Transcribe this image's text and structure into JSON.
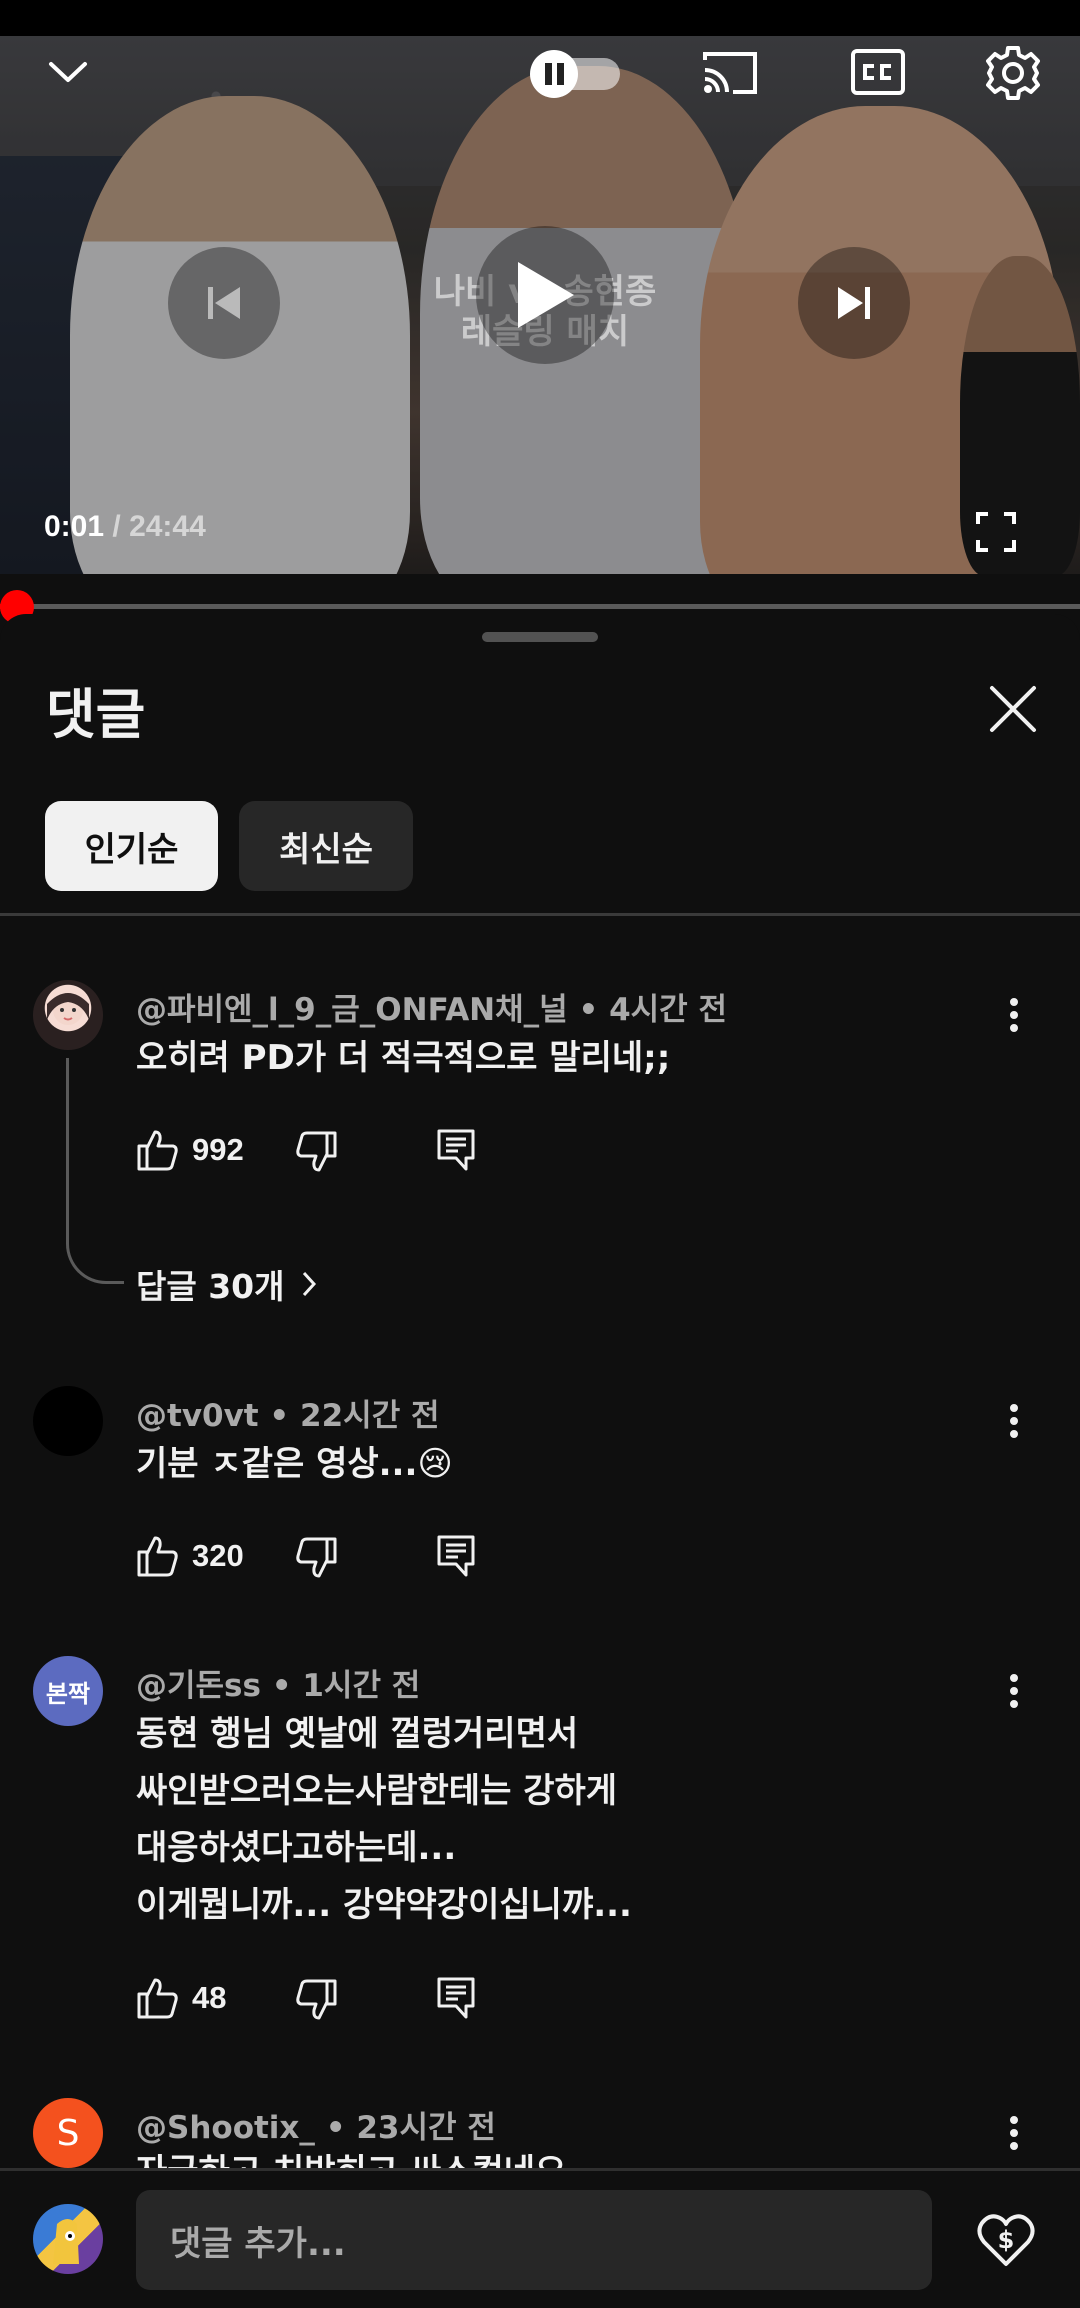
{
  "player": {
    "overlay_text_line1": "나비 vs 송현종",
    "overlay_text_line2": "레슬링 매치",
    "current_time": "0:01",
    "total_time": "24:44",
    "progress_fraction": 0.0004,
    "icons": [
      "chevron-down-icon",
      "pause-icon",
      "cast-icon",
      "cc-icon",
      "gear-icon",
      "previous-icon",
      "play-icon",
      "next-icon",
      "fullscreen-icon"
    ]
  },
  "comments_sheet": {
    "title": "댓글",
    "sort_chips": [
      {
        "label": "인기순",
        "selected": true
      },
      {
        "label": "최신순",
        "selected": false
      }
    ]
  },
  "comments": [
    {
      "author": "@파비엔_l_9_금_ONFAN채_널",
      "time": "4시간 전",
      "text_lines": [
        "오히려 PD가 더 적극적으로 말리네;;"
      ],
      "likes": "992",
      "replies_label": "답글 30개"
    },
    {
      "author": "@tv0vt",
      "time": "22시간 전",
      "text_lines": [
        "기분 ㅈ같은 영상...😢"
      ],
      "likes": "320"
    },
    {
      "author": "@기돈ss",
      "time": "1시간 전",
      "avatar_text": "본짝",
      "text_lines": [
        "동현 행님 옛날에 껄렁거리면서",
        "싸인받으러오는사람한테는 강하게",
        "대응하셨다고하는데...",
        "이게뭡니까... 강약약강이십니꺄..."
      ],
      "likes": "48"
    },
    {
      "author": "@Shootix_",
      "time": "23시간 전",
      "avatar_text": "S",
      "text_lines": [
        "자극하고 치받히고 싸스컸네요"
      ]
    }
  ],
  "input_bar": {
    "placeholder": "댓글 추가..."
  },
  "colors": {
    "background": "#0f0f0f",
    "chip_selected": "#f1f1f1",
    "chip_default": "#272727",
    "progress_red": "#ff0000",
    "secondary_text": "#aaaaaa"
  }
}
